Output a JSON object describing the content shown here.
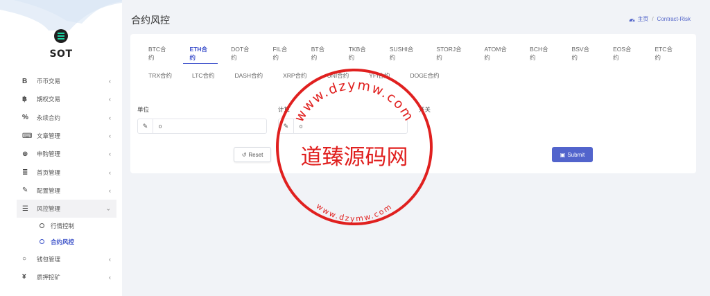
{
  "brand": {
    "name": "SOT"
  },
  "sidebar": {
    "items": [
      {
        "icon": "bitcoin-icon",
        "glyph": "B",
        "label": "币币交易"
      },
      {
        "icon": "bitcoin-icon",
        "glyph": "฿",
        "label": "期权交易"
      },
      {
        "icon": "link-icon",
        "glyph": "%",
        "label": "永续合约"
      },
      {
        "icon": "keyboard-icon",
        "glyph": "⌨",
        "label": "文章管理"
      },
      {
        "icon": "lifebuoy-icon",
        "glyph": "⊕",
        "label": "申购管理"
      },
      {
        "icon": "list-icon",
        "glyph": "≣",
        "label": "首页管理"
      },
      {
        "icon": "wrench-icon",
        "glyph": "✎",
        "label": "配置管理"
      },
      {
        "icon": "list-details-icon",
        "glyph": "☰",
        "label": "风控管理",
        "subitems": [
          "行情控制",
          "合约风控"
        ]
      },
      {
        "icon": "circle-icon",
        "glyph": "○",
        "label": "钱包管理"
      },
      {
        "icon": "yen-icon",
        "glyph": "¥",
        "label": "质押挖矿"
      }
    ]
  },
  "header": {
    "title": "合约风控",
    "breadcrumb": {
      "home": "主页",
      "current": "Contract-Risk"
    }
  },
  "tabs": {
    "row1": [
      "BTC合约",
      "ETH合约",
      "DOT合约",
      "FIL合约",
      "BT合约",
      "TKB合约",
      "SUSHI合约",
      "STORJ合约",
      "ATOM合约",
      "BCH合约",
      "BSV合约",
      "EOS合约",
      "ETC合约"
    ],
    "row2": [
      "TRX合约",
      "LTC合约",
      "DASH合约",
      "XRP合约",
      "UNI合约",
      "YFI合约",
      "DOGE合约"
    ],
    "active": "ETH合约"
  },
  "form": {
    "unit_label": "单位",
    "unit_value": "0",
    "calc_label": "计算",
    "calc_value": "0",
    "switch_label": "开关"
  },
  "buttons": {
    "reset": "Reset",
    "submit": "Submit"
  },
  "watermark": {
    "center": "道臻源码网",
    "top_arc": "www.dzymw.com",
    "bottom_arc": "www.dzymw.com"
  },
  "colors": {
    "accent": "#3a4ecb",
    "submit": "#5264cc",
    "stamp": "#e0201f"
  }
}
